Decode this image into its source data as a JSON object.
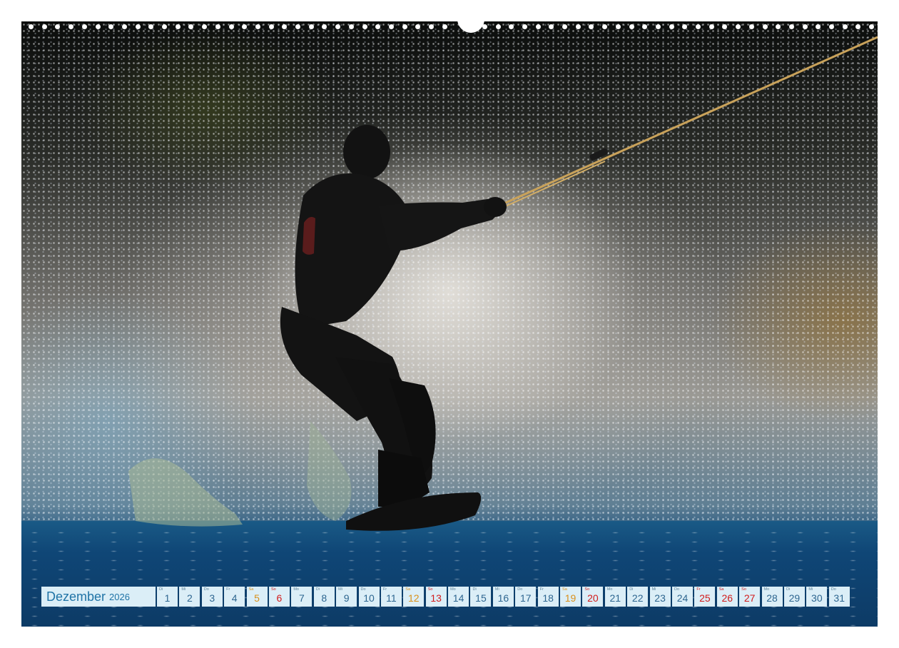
{
  "calendar": {
    "month": "Dezember",
    "year": "2026",
    "days": [
      {
        "wd": "Di",
        "d": "1",
        "type": "weekday"
      },
      {
        "wd": "Mi",
        "d": "2",
        "type": "weekday"
      },
      {
        "wd": "Do",
        "d": "3",
        "type": "weekday"
      },
      {
        "wd": "Fr",
        "d": "4",
        "type": "weekday"
      },
      {
        "wd": "Sa",
        "d": "5",
        "type": "saturday"
      },
      {
        "wd": "So",
        "d": "6",
        "type": "sunday"
      },
      {
        "wd": "Mo",
        "d": "7",
        "type": "weekday"
      },
      {
        "wd": "Di",
        "d": "8",
        "type": "weekday"
      },
      {
        "wd": "Mi",
        "d": "9",
        "type": "weekday"
      },
      {
        "wd": "Do",
        "d": "10",
        "type": "weekday"
      },
      {
        "wd": "Fr",
        "d": "11",
        "type": "weekday"
      },
      {
        "wd": "Sa",
        "d": "12",
        "type": "saturday"
      },
      {
        "wd": "So",
        "d": "13",
        "type": "sunday"
      },
      {
        "wd": "Mo",
        "d": "14",
        "type": "weekday"
      },
      {
        "wd": "Di",
        "d": "15",
        "type": "weekday"
      },
      {
        "wd": "Mi",
        "d": "16",
        "type": "weekday"
      },
      {
        "wd": "Do",
        "d": "17",
        "type": "weekday"
      },
      {
        "wd": "Fr",
        "d": "18",
        "type": "weekday"
      },
      {
        "wd": "Sa",
        "d": "19",
        "type": "saturday"
      },
      {
        "wd": "So",
        "d": "20",
        "type": "sunday"
      },
      {
        "wd": "Mo",
        "d": "21",
        "type": "weekday"
      },
      {
        "wd": "Di",
        "d": "22",
        "type": "weekday"
      },
      {
        "wd": "Mi",
        "d": "23",
        "type": "weekday"
      },
      {
        "wd": "Do",
        "d": "24",
        "type": "weekday"
      },
      {
        "wd": "Fr",
        "d": "25",
        "type": "holiday"
      },
      {
        "wd": "Sa",
        "d": "26",
        "type": "holiday"
      },
      {
        "wd": "So",
        "d": "27",
        "type": "sunday"
      },
      {
        "wd": "Mo",
        "d": "28",
        "type": "weekday"
      },
      {
        "wd": "Di",
        "d": "29",
        "type": "weekday"
      },
      {
        "wd": "Mi",
        "d": "30",
        "type": "weekday"
      },
      {
        "wd": "Do",
        "d": "31",
        "type": "weekday"
      }
    ]
  },
  "colors": {
    "accent": "#1f73a6",
    "cell_background": "#dbeef7",
    "saturday": "#d9901a",
    "sunday": "#d21c1c"
  },
  "photo": {
    "icons": [
      "wakeboarder-silhouette",
      "water-spray",
      "tow-rope",
      "wakeboard"
    ]
  }
}
